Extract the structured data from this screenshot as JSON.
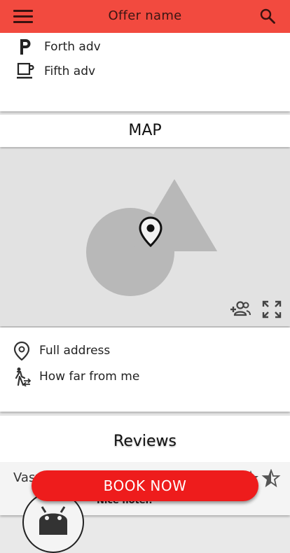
{
  "header": {
    "title": "Offer name",
    "menu_icon": "menu-icon",
    "search_icon": "search-icon",
    "color": "#f24a3f"
  },
  "advantages": [
    {
      "label": "Forth adv",
      "icon": "parking-icon"
    },
    {
      "label": "Fifth adv",
      "icon": "coffee-icon"
    }
  ],
  "map": {
    "title": "MAP",
    "pin_icon": "map-pin-icon",
    "controls": [
      {
        "icon": "add-people-icon"
      },
      {
        "icon": "fullscreen-icon"
      }
    ]
  },
  "address": {
    "full_address": "Full address",
    "distance": "How far from me"
  },
  "reviews": {
    "title": "Reviews",
    "items": [
      {
        "author": "Vasya Pupkin",
        "text": "Nice hotel!",
        "rating": 4.5
      }
    ]
  },
  "actions": {
    "book_now": "BOOK NOW",
    "accent": "#ee1c1c"
  }
}
